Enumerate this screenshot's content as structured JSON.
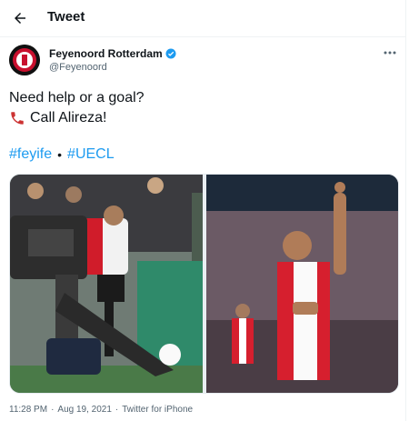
{
  "header": {
    "title": "Tweet"
  },
  "author": {
    "name": "Feyenoord Rotterdam",
    "handle": "@Feyenoord",
    "verified_color": "#1d9bf0"
  },
  "tweet": {
    "line1": "Need help or a goal?",
    "line2": "Call Alireza!",
    "hashtags": [
      "#feyife",
      "#UECL"
    ],
    "separator": "•"
  },
  "meta": {
    "time": "11:28 PM",
    "dot1": "·",
    "date": "Aug 19, 2021",
    "dot2": "·",
    "source": "Twitter for iPhone"
  },
  "icons": {
    "back": "arrow-left-icon",
    "more": "more-horizontal-icon",
    "phone": "telephone-receiver-icon",
    "verified": "verified-badge-icon"
  }
}
